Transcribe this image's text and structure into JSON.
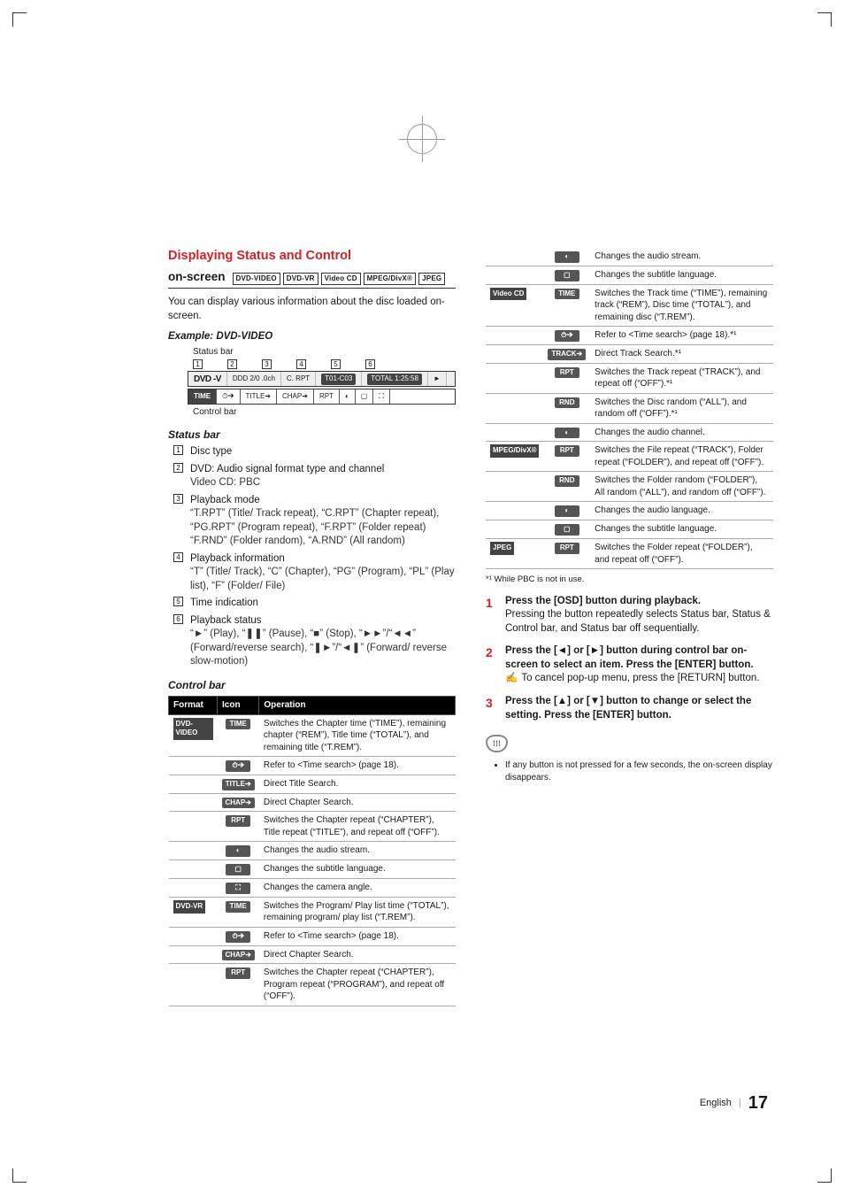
{
  "heading": "Displaying Status and Control",
  "subhead_label": "on-screen",
  "disc_badges": [
    "DVD-VIDEO",
    "DVD-VR",
    "Video CD",
    "MPEG/DivX®",
    "JPEG"
  ],
  "intro": "You can display various information about the disc loaded on-screen.",
  "example_title": "Example: DVD-VIDEO",
  "fig": {
    "status_label": "Status bar",
    "control_label": "Control bar",
    "markers": [
      "1",
      "2",
      "3",
      "4",
      "5",
      "6"
    ],
    "status_cells": {
      "disc": "DVD -V",
      "audio": "DDD 2/0 .0ch",
      "mode": "C. RPT",
      "info": "T01-C03",
      "total": "TOTAL 1:25:58",
      "play": "►"
    },
    "control_cells": [
      "TIME",
      "⏱➔",
      "TITLE➔",
      "CHAP➔",
      "RPT",
      "◐",
      "▢",
      "⛶"
    ]
  },
  "statusbar_title": "Status bar",
  "status_items_num": [
    "1",
    "2",
    "3",
    "4",
    "5",
    "6"
  ],
  "status_items": [
    {
      "t": "Disc type",
      "s": []
    },
    {
      "t": "DVD: Audio signal format type and channel",
      "s": [
        "Video CD: PBC"
      ]
    },
    {
      "t": "Playback mode",
      "s": [
        "“T.RPT” (Title/ Track repeat), “C.RPT” (Chapter repeat), “PG.RPT” (Program repeat), “F.RPT” (Folder repeat)",
        "“F.RND” (Folder random), “A.RND” (All random)"
      ]
    },
    {
      "t": "Playback information",
      "s": [
        "“T” (Title/ Track), “C” (Chapter), “PG” (Program), “PL” (Play list), “F” (Folder/ File)"
      ]
    },
    {
      "t": "Time indication",
      "s": []
    },
    {
      "t": "Playback status",
      "s": [
        "“►” (Play), “❚❚” (Pause), “■” (Stop), “►►”/“◄◄” (Forward/reverse search), “❚►”/“◄❚” (Forward/ reverse slow-motion)"
      ]
    }
  ],
  "controlbar_title": "Control bar",
  "table_head": [
    "Format",
    "Icon",
    "Operation"
  ],
  "rows": [
    {
      "fmt": "DVD-VIDEO",
      "icon": "TIME",
      "op": "Switches the Chapter time (“TIME”), remaining chapter (“REM”), Title time (“TOTAL”), and remaining title (“T.REM”)."
    },
    {
      "fmt": "",
      "icon": "⏱➔",
      "op": "Refer to <Time search> (page 18)."
    },
    {
      "fmt": "",
      "icon": "TITLE➔",
      "op": "Direct Title Search."
    },
    {
      "fmt": "",
      "icon": "CHAP➔",
      "op": "Direct Chapter Search."
    },
    {
      "fmt": "",
      "icon": "RPT",
      "op": "Switches the Chapter repeat (“CHAPTER”), Title repeat (“TITLE”), and repeat off (“OFF”)."
    },
    {
      "fmt": "",
      "icon": "◐",
      "op": "Changes the audio stream."
    },
    {
      "fmt": "",
      "icon": "▢",
      "op": "Changes the subtitle language."
    },
    {
      "fmt": "",
      "icon": "⛶",
      "op": "Changes the camera angle."
    },
    {
      "fmt": "DVD-VR",
      "icon": "TIME",
      "op": "Switches the Program/ Play list time (“TOTAL”), remaining program/ play list (“T.REM”)."
    },
    {
      "fmt": "",
      "icon": "⏱➔",
      "op": "Refer to <Time search> (page 18)."
    },
    {
      "fmt": "",
      "icon": "CHAP➔",
      "op": "Direct Chapter Search."
    },
    {
      "fmt": "",
      "icon": "RPT",
      "op": "Switches the Chapter repeat (“CHAPTER”), Program repeat (“PROGRAM”), and repeat off (“OFF”)."
    },
    {
      "fmt": "",
      "icon": "◐",
      "op": "Changes the audio stream."
    },
    {
      "fmt": "",
      "icon": "▢",
      "op": "Changes the subtitle language."
    },
    {
      "fmt": "Video CD",
      "icon": "TIME",
      "op": "Switches the Track time (“TIME”), remaining track (“REM”), Disc time (“TOTAL”), and remaining disc (“T.REM”)."
    },
    {
      "fmt": "",
      "icon": "⏱➔",
      "op": "Refer to <Time search> (page 18).*¹"
    },
    {
      "fmt": "",
      "icon": "TRACK➔",
      "op": "Direct Track Search.*¹"
    },
    {
      "fmt": "",
      "icon": "RPT",
      "op": "Switches the Track repeat (“TRACK”), and repeat off (“OFF”).*¹"
    },
    {
      "fmt": "",
      "icon": "RND",
      "op": "Switches the Disc random (“ALL”), and random off (“OFF”).*¹"
    },
    {
      "fmt": "",
      "icon": "◐",
      "op": "Changes the audio channel."
    },
    {
      "fmt": "MPEG/DivX®",
      "icon": "RPT",
      "op": "Switches the File repeat (“TRACK”), Folder repeat (“FOLDER”), and repeat off (“OFF”)."
    },
    {
      "fmt": "",
      "icon": "RND",
      "op": "Switches the Folder random (“FOLDER”), All random (“ALL”), and random off (“OFF”)."
    },
    {
      "fmt": "",
      "icon": "◐",
      "op": "Changes the audio language."
    },
    {
      "fmt": "",
      "icon": "▢",
      "op": "Changes the subtitle language."
    },
    {
      "fmt": "JPEG",
      "icon": "RPT",
      "op": "Switches the Folder repeat (“FOLDER”), and repeat off (“OFF”)."
    }
  ],
  "footnote": "*¹ While PBC is not in use.",
  "steps": [
    {
      "lead": "Press the [OSD] button during playback.",
      "body": "Pressing the button repeatedly selects Status bar, Status & Control bar, and Status bar off sequentially."
    },
    {
      "lead": "Press the [◄] or [►] button during control bar on-screen to select an item. Press the [ENTER] button.",
      "note": "To cancel pop-up menu, press the [RETURN] button."
    },
    {
      "lead": "Press the [▲] or [▼] button to change or select the setting. Press the [ENTER] button."
    }
  ],
  "tip_badge": "⁞⁞⁞",
  "tip": "If any button is not pressed for a few seconds, the on-screen display disappears.",
  "footer_lang": "English",
  "footer_page": "17"
}
